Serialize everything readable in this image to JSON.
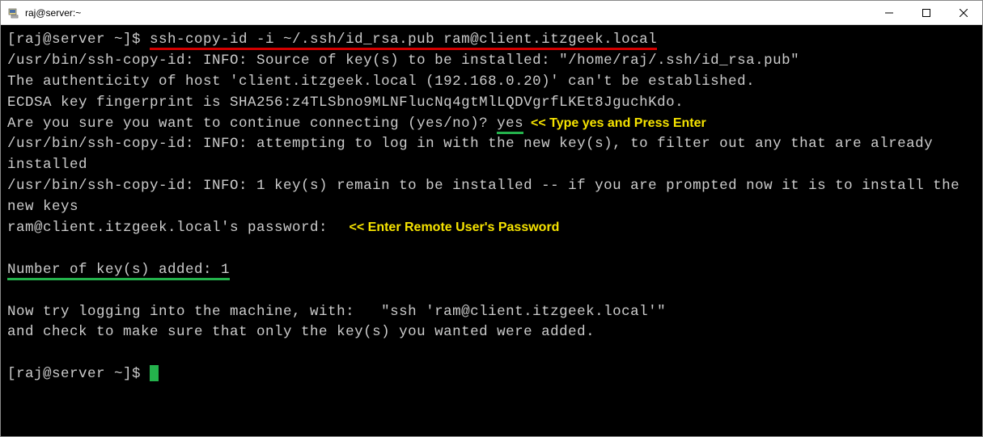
{
  "window": {
    "title": "raj@server:~"
  },
  "terminal": {
    "prompt1_prefix": "[raj@server ~]$ ",
    "command": "ssh-copy-id -i ~/.ssh/id_rsa.pub ram@client.itzgeek.local",
    "out1": "/usr/bin/ssh-copy-id: INFO: Source of key(s) to be installed: \"/home/raj/.ssh/id_rsa.pub\"",
    "out2": "The authenticity of host 'client.itzgeek.local (192.168.0.20)' can't be established.",
    "out3": "ECDSA key fingerprint is SHA256:z4TLSbno9MLNFlucNq4gtMlLQDVgrfLKEt8JguchKdo.",
    "out4_prefix": "Are you sure you want to continue connecting (yes/no)? ",
    "answer_yes": "yes",
    "annot_yes": "  << Type yes and Press Enter",
    "out5": "/usr/bin/ssh-copy-id: INFO: attempting to log in with the new key(s), to filter out any that are already installed",
    "out6": "/usr/bin/ssh-copy-id: INFO: 1 key(s) remain to be installed -- if you are prompted now it is to install the new keys",
    "out7_prefix": "ram@client.itzgeek.local's password:  ",
    "annot_pw": " << Enter Remote User's Password",
    "out8": "Number of key(s) added: 1",
    "out9": "Now try logging into the machine, with:   \"ssh 'ram@client.itzgeek.local'\"",
    "out10": "and check to make sure that only the key(s) you wanted were added.",
    "prompt2": "[raj@server ~]$ "
  }
}
